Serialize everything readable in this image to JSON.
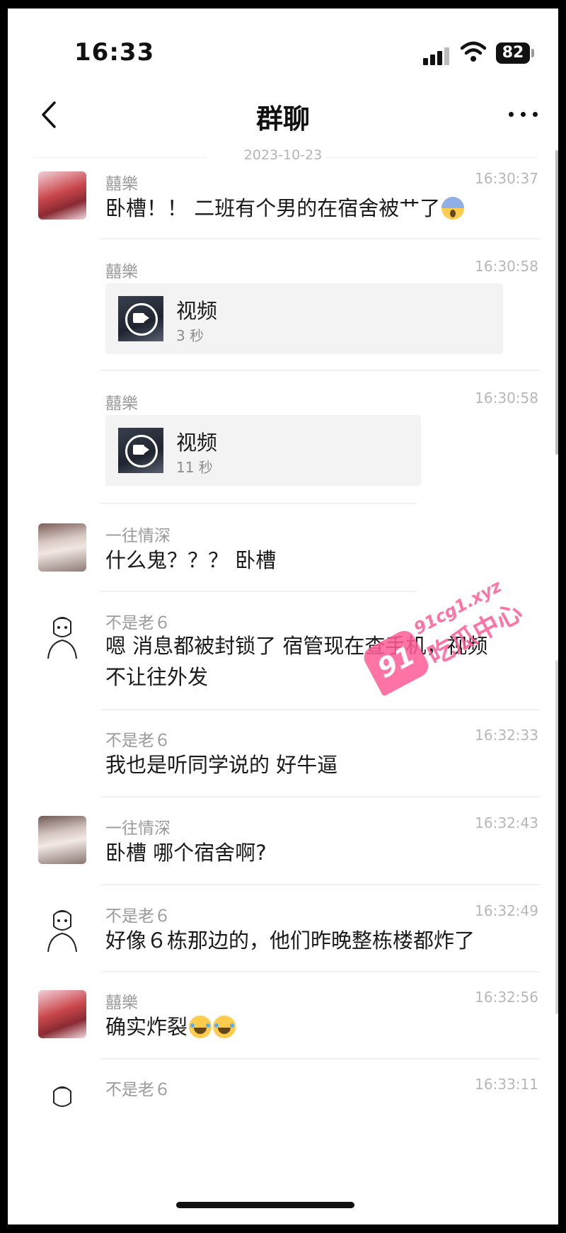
{
  "status": {
    "time": "16:33",
    "battery": "82"
  },
  "nav": {
    "title": "群聊"
  },
  "date_divider": "2023-10-23",
  "messages": [
    {
      "sender": "囍樂",
      "time": "16:30:37",
      "text": "卧槽！！ 二班有个男的在宿舍被艹了",
      "emoji": "scream-face"
    },
    {
      "sender": "囍樂",
      "time": "16:30:58",
      "video_label": "视频",
      "video_duration": "3 秒"
    },
    {
      "sender": "囍樂",
      "time": "16:30:58",
      "video_label": "视频",
      "video_duration": "11 秒"
    },
    {
      "sender": "一往情深",
      "text": "什么鬼？？？ 卧槽"
    },
    {
      "sender": "不是老６",
      "text_line1": "嗯 消息都被封锁了 宿管现在查手机，视频",
      "text_line2": "不让往外发"
    },
    {
      "sender": "不是老６",
      "time": "16:32:33",
      "text": "我也是听同学说的 好牛逼"
    },
    {
      "sender": "一往情深",
      "time": "16:32:43",
      "text": "卧槽 哪个宿舍啊?"
    },
    {
      "sender": "不是老６",
      "time": "16:32:49",
      "text": "好像６栋那边的，他们昨晚整栋楼都炸了"
    },
    {
      "sender": "囍樂",
      "time": "16:32:56",
      "text": "确实炸裂",
      "emoji": "laughing-tears-face"
    },
    {
      "sender": "不是老６",
      "time": "16:33:11"
    }
  ],
  "watermark": {
    "badge": "91",
    "site": "91cg1.xyz",
    "text": "吃瓜中心"
  },
  "colors": {
    "background": "#ffffff",
    "sender": "#9a9a9a",
    "timestamp": "#b7b7b7",
    "watermark": "#ff5c95"
  }
}
